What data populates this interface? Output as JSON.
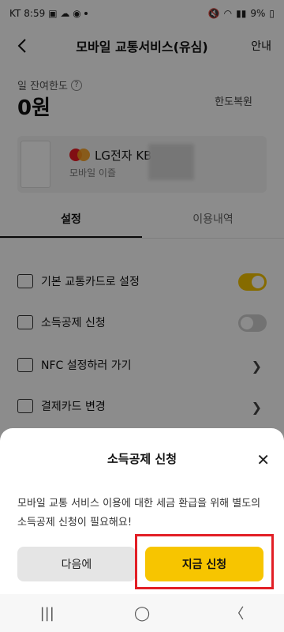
{
  "status": {
    "carrier": "KT",
    "time": "8:59",
    "battery": "9%"
  },
  "header": {
    "title": "모바일 교통서비스(유심)",
    "guide_label": "안내"
  },
  "limit": {
    "label": "일 잔여한도",
    "value": "0원",
    "restore_label": "한도복원"
  },
  "card": {
    "name": "LG전자 KB",
    "sub": "모바일 이즐"
  },
  "tabs": [
    {
      "label": "설정"
    },
    {
      "label": "이용내역"
    }
  ],
  "settings": [
    {
      "label": "기본 교통카드로 설정",
      "control": "toggle-on"
    },
    {
      "label": "소득공제 신청",
      "control": "toggle-off"
    },
    {
      "label": "NFC 설정하러 가기",
      "control": "chevron"
    },
    {
      "label": "결제카드 변경",
      "control": "chevron"
    }
  ],
  "sheet": {
    "title": "소득공제 신청",
    "message": "모바일 교통 서비스 이용에 대한 세금 환급을 위해 별도의 소득공제 신청이 필요해요!",
    "next_label": "다음에",
    "apply_label": "지금 신청"
  },
  "colors": {
    "accent": "#f7c500",
    "highlight": "#e21f26"
  }
}
